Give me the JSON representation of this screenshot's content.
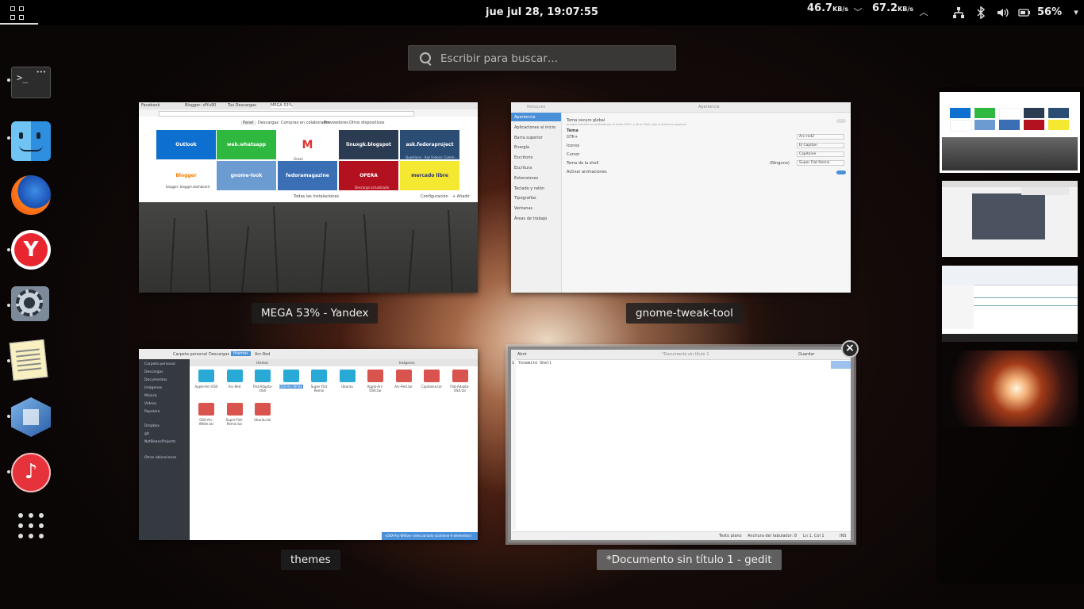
{
  "topbar": {
    "clock": "jue jul 28, 19:07:55",
    "download_value": "46.7",
    "download_unit": "KB/s",
    "upload_value": "67.2",
    "upload_unit": "KB/s",
    "battery": "56%"
  },
  "search": {
    "placeholder": "Escribir para buscar…"
  },
  "windows": {
    "yandex": {
      "caption": "MEGA 53% - Yandex",
      "tabs": [
        "Facebook",
        "Blogger: sFfu90",
        "Tus Descargas",
        "MEGA 53%"
      ],
      "nav": [
        "Panel",
        "Descargas",
        "Compras en colaborador",
        "Proveedores",
        "Otros dispositivos"
      ],
      "tiles": [
        {
          "label": "Outlook",
          "color": "#0d6fcf"
        },
        {
          "label": "web.whatsapp",
          "color": "#2fb83f"
        },
        {
          "label": "Gmail",
          "color": "#ffffff"
        },
        {
          "label": "linuxgk.blogspot",
          "color": "#2a3b52"
        },
        {
          "label": "ask.fedoraproject",
          "color": "#2b4d74"
        },
        {
          "label": "Blogger",
          "color": "#ffffff"
        },
        {
          "label": "gnome-look",
          "color": "#6c9bd2"
        },
        {
          "label": "fedoramagazine",
          "color": "#3a6fb5"
        },
        {
          "label": "OPERA",
          "color": "#b3111f"
        },
        {
          "label": "mercado libre",
          "color": "#f5e830"
        }
      ],
      "tile_sub": [
        "",
        "",
        "Gmail",
        "",
        "Questions · Ask Fedora: Comm...",
        "blogger: blogger.dashboard",
        "",
        "",
        "Descarga actualizado",
        ""
      ],
      "footer": "Todas las instalaciones",
      "footer_right": "Configuración",
      "footer_right2": "+ Añadir"
    },
    "tweak": {
      "caption": "gnome-tweak-tool",
      "title": "Apariencia",
      "search": "Retoques",
      "sidebar": [
        "Apariencia",
        "Aplicaciones al inicio",
        "Barra superior",
        "Energía",
        "Escritorio",
        "Escritura",
        "Extensiones",
        "Teclado y ratón",
        "Tipografías",
        "Ventanas",
        "Áreas de trabajo"
      ],
      "dark_theme": "Tema oscuro global",
      "dark_theme_sub": "Aunque también es aplicada por el tema GTK+ y de la Shell, solo si temas lo soportan",
      "section": "Tema",
      "rows": [
        {
          "label": "GTK+",
          "value": "Arc-red2"
        },
        {
          "label": "Iconos",
          "value": "El Capitan"
        },
        {
          "label": "Cursor",
          "value": "Capitaine"
        },
        {
          "label": "Tema de la shell",
          "value": "Super Flat Remix"
        }
      ],
      "shell_extra": "(Ninguno)",
      "animations": "Activar animaciones"
    },
    "nautilus": {
      "caption": "themes",
      "path": [
        "Carpeta personal",
        "Descargas",
        "themes",
        "Arc-Red"
      ],
      "sidebar": [
        "Carpeta personal",
        "Descargas",
        "Documentos",
        "Imágenes",
        "Música",
        "Vídeos",
        "Papelera",
        "Dropbox",
        "git",
        "NetBeansProjects",
        "Otras ubicaciones"
      ],
      "tab1": "themes",
      "tab2": "Imágenes",
      "files": [
        "Apple-Arc-OSX",
        "Arc-Red",
        "Flat-Adapta-OSX",
        "OSX-Arc-White",
        "Super Flat Remix",
        "Ubuntu",
        "Apple-Arc-OSX.tar",
        "Arc-Red.tar",
        "Capitaine.tar",
        "Flat-Adapta-OSX.tar",
        "OSX-Arc-White.tar",
        "Super-Flat-Remix.tar",
        "Ubuntu.tar"
      ],
      "status": "«OSX-Arc-White» seleccionado (contiene 9 elementos)"
    },
    "gedit": {
      "caption": "*Documento sin título 1 - gedit",
      "title": "*Documento sin título 1",
      "open": "Abrir",
      "save": "Guardar",
      "text": "Yosemite Shell",
      "status_mode": "Texto plano",
      "status_tab": "Anchura del tabulador: 8",
      "status_pos": "Ln 1, Col 1",
      "status_ins": "INS"
    }
  },
  "icons": {
    "activities": "apps-grid-icon",
    "dash_apps": [
      "terminal",
      "finder",
      "firefox",
      "yandex",
      "settings",
      "notes",
      "virtualbox",
      "music",
      "show-apps"
    ]
  },
  "colors": {
    "panel": "#000000",
    "accent": "#4a90d9"
  }
}
